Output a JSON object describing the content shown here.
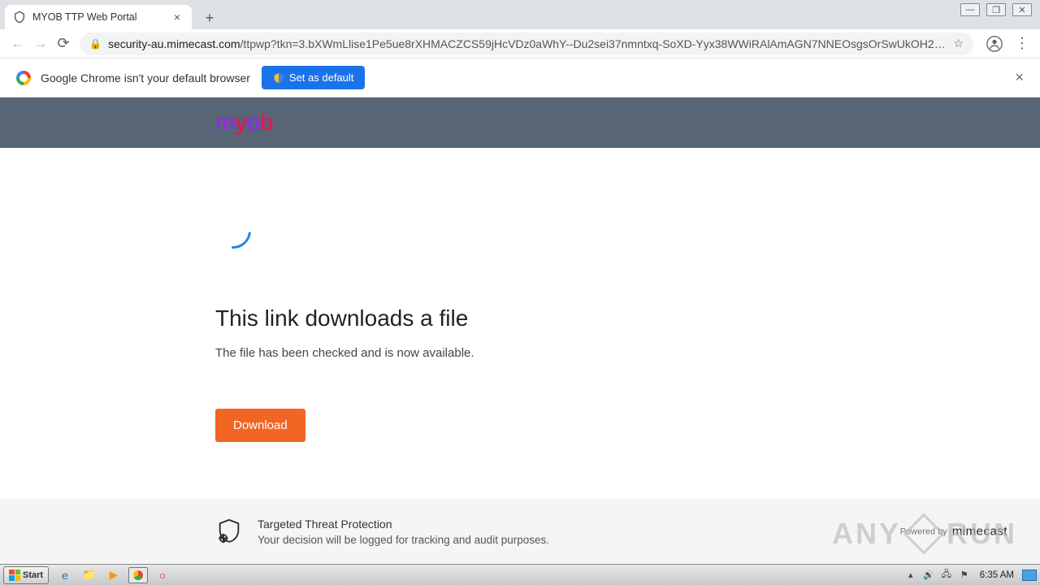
{
  "browser": {
    "tab_title": "MYOB TTP Web Portal",
    "url_host": "security-au.mimecast.com",
    "url_path": "/ttpwp?tkn=3.bXWmLlise1Pe5ue8rXHMACZCS59jHcVDz0aWhY--Du2sei37nmntxq-SoXD-Yyx38WWiRAlAmAGN7NNEOsgsOrSwUkOH2EwZ…",
    "infobar_msg": "Google Chrome isn't your default browser",
    "set_default_label": "Set as default"
  },
  "page": {
    "logo_text": "myob",
    "heading": "This link downloads a file",
    "subtext": "The file has been checked and is now available.",
    "download_label": "Download"
  },
  "footer": {
    "line1": "Targeted Threat Protection",
    "line2": "Your decision will be logged for tracking and audit purposes.",
    "powered_prefix": "Powered by",
    "powered_brand": "mimecast"
  },
  "watermark": {
    "left": "ANY",
    "right": "RUN"
  },
  "taskbar": {
    "start_label": "Start",
    "clock": "6:35 AM"
  }
}
